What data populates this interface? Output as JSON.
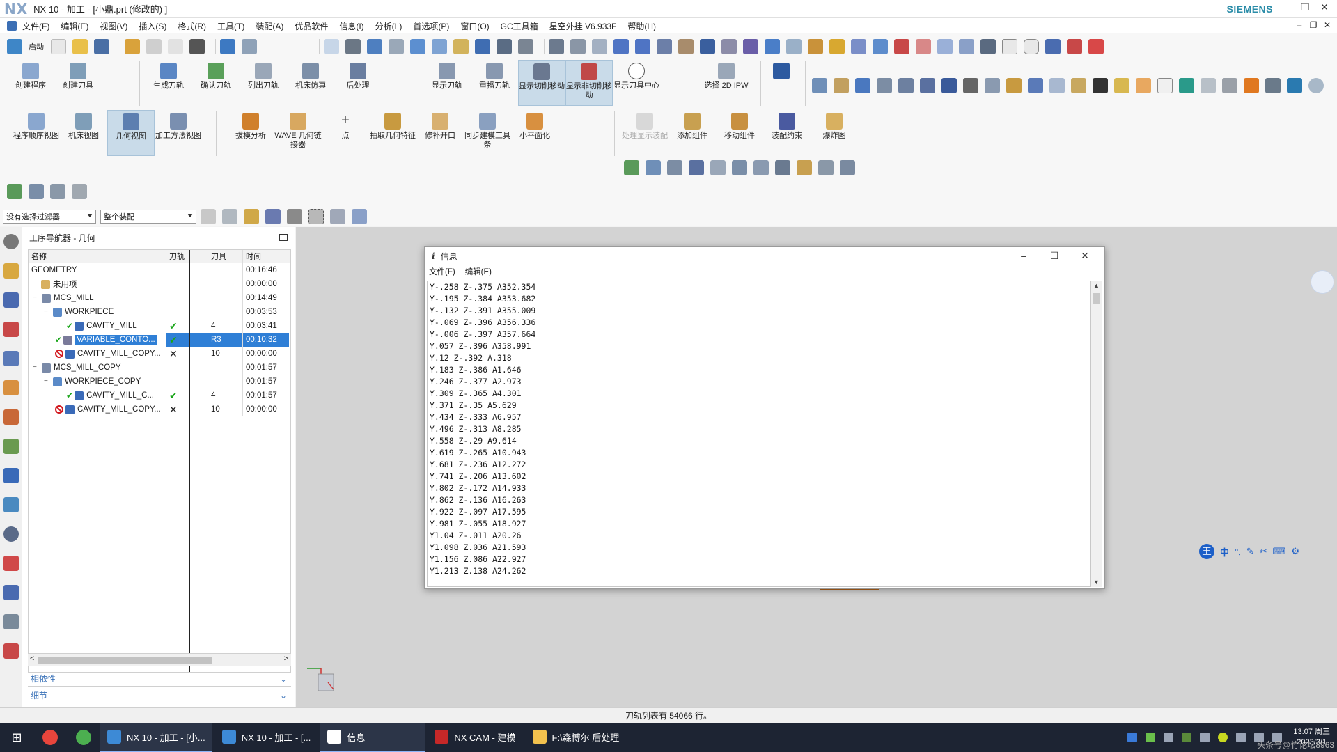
{
  "window": {
    "logo": "NX",
    "title": "NX 10 - 加工 - [小鼎.prt (修改的) ]",
    "brand": "SIEMENS",
    "controls": [
      "–",
      "❐",
      "✕"
    ]
  },
  "menubar": {
    "items": [
      "文件(F)",
      "编辑(E)",
      "视图(V)",
      "插入(S)",
      "格式(R)",
      "工具(T)",
      "装配(A)",
      "优品软件",
      "信息(I)",
      "分析(L)",
      "首选项(P)",
      "窗口(O)",
      "GC工具箱",
      "星空外挂 V6.933F",
      "帮助(H)"
    ]
  },
  "quick_access": {
    "start_label": "启动"
  },
  "ribbon": {
    "row1_groups": [
      [
        "创建程序",
        "创建刀具"
      ],
      [
        "生成刀轨",
        "确认刀轨",
        "列出刀轨",
        "机床仿真",
        "后处理"
      ],
      [
        "显示刀轨",
        "重播刀轨",
        "显示切削移动",
        "显示非切削移动",
        "显示刀具中心"
      ],
      [
        "选择 2D IPW"
      ]
    ],
    "row2_groups": [
      [
        "程序顺序视图",
        "机床视图",
        "几何视图",
        "加工方法视图"
      ],
      [
        "拔模分析",
        "WAVE 几何链接器",
        "点",
        "抽取几何特征",
        "修补开口",
        "同步建模工具条",
        "小平面化"
      ],
      [
        "处理显示装配",
        "添加组件",
        "移动组件",
        "装配约束",
        "爆炸图"
      ]
    ],
    "active_tool": "几何视图"
  },
  "filters": {
    "selection_filter": "没有选择过滤器",
    "assembly_scope": "整个装配"
  },
  "navigator": {
    "title": "工序导航器 - 几何",
    "columns": [
      "名称",
      "刀轨",
      "刀具",
      "时间"
    ],
    "rows": [
      {
        "name": "GEOMETRY",
        "path": "",
        "tool": "",
        "time": "00:16:46",
        "status": ""
      },
      {
        "name": "未用项",
        "path": "",
        "tool": "",
        "time": "00:00:00",
        "status": ""
      },
      {
        "name": "MCS_MILL",
        "path": "",
        "tool": "",
        "time": "00:14:49",
        "status": ""
      },
      {
        "name": "WORKPIECE",
        "path": "",
        "tool": "",
        "time": "00:03:53",
        "status": ""
      },
      {
        "name": "CAVITY_MILL",
        "path": "✔",
        "tool": "4",
        "time": "00:03:41",
        "status": "ok"
      },
      {
        "name": "VARIABLE_CONTO...",
        "path": "✔",
        "tool": "R3",
        "time": "00:10:32",
        "status": "ok"
      },
      {
        "name": "CAVITY_MILL_COPY...",
        "path": "✕",
        "tool": "10",
        "time": "00:00:00",
        "status": "bad"
      },
      {
        "name": "MCS_MILL_COPY",
        "path": "",
        "tool": "",
        "time": "00:01:57",
        "status": ""
      },
      {
        "name": "WORKPIECE_COPY",
        "path": "",
        "tool": "",
        "time": "00:01:57",
        "status": ""
      },
      {
        "name": "CAVITY_MILL_C...",
        "path": "✔",
        "tool": "4",
        "time": "00:01:57",
        "status": "ok"
      },
      {
        "name": "CAVITY_MILL_COPY...",
        "path": "✕",
        "tool": "10",
        "time": "00:00:00",
        "status": "bad"
      }
    ],
    "panels": [
      "相依性",
      "细节"
    ]
  },
  "info_dialog": {
    "title": "信息",
    "menu": [
      "文件(F)",
      "编辑(E)"
    ],
    "lines": [
      "Y-.258 Z-.375 A352.354",
      "Y-.195 Z-.384 A353.682",
      "Y-.132 Z-.391 A355.009",
      "Y-.069 Z-.396 A356.336",
      "Y-.006 Z-.397 A357.664",
      "Y.057 Z-.396 A358.991",
      "Y.12 Z-.392 A.318",
      "Y.183 Z-.386 A1.646",
      "Y.246 Z-.377 A2.973",
      "Y.309 Z-.365 A4.301",
      "Y.371 Z-.35 A5.629",
      "Y.434 Z-.333 A6.957",
      "Y.496 Z-.313 A8.285",
      "Y.558 Z-.29 A9.614",
      "Y.619 Z-.265 A10.943",
      "Y.681 Z-.236 A12.272",
      "Y.741 Z-.206 A13.602",
      "Y.802 Z-.172 A14.933",
      "Y.862 Z-.136 A16.263",
      "Y.922 Z-.097 A17.595",
      "Y.981 Z-.055 A18.927",
      "Y1.04 Z-.011 A20.26",
      "Y1.098 Z.036 A21.593",
      "Y1.156 Z.086 A22.927",
      "Y1.213 Z.138 A24.262"
    ]
  },
  "ime": [
    "中",
    "°,",
    "✎",
    "✂",
    "⌨",
    "⚙"
  ],
  "status_text": "刀轨列表有 54066 行。",
  "taskbar": {
    "items": [
      "NX 10 - 加工 - [小...",
      "NX 10 - 加工 - [...",
      "信息",
      "NX CAM - 建模",
      "F:\\森博尔 后处理"
    ],
    "time": "13:07 周三",
    "date": "2023/3/1",
    "watermark": "头条号@竹论坛8963"
  }
}
